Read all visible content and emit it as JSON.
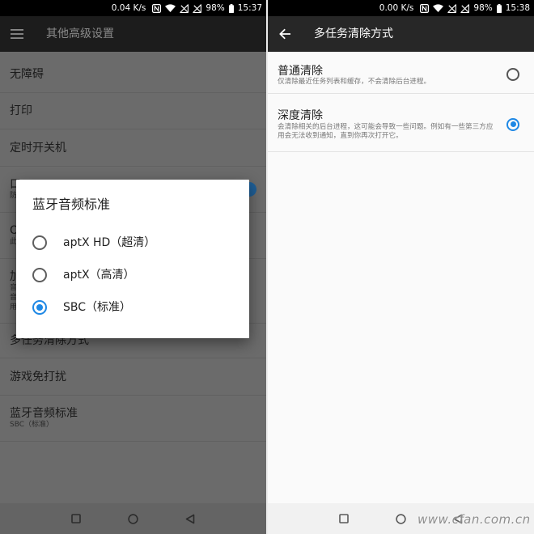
{
  "left_screen": {
    "status_bar": {
      "net_speed": "0.04 K/s",
      "battery_percent": "98%",
      "time": "15:37",
      "icons": [
        "nfc-icon",
        "wifi-icon",
        "no-signal-icon",
        "no-signal-icon",
        "battery-icon"
      ]
    },
    "toolbar": {
      "menu_icon": "menu-icon",
      "title": "其他高级设置"
    },
    "settings_list": [
      {
        "title": "无障碍"
      },
      {
        "title": "打印"
      },
      {
        "title": "定时开关机"
      },
      {
        "title": "口",
        "subtitle": "防",
        "toggle_on": true
      },
      {
        "title": "O",
        "subtitle": "此"
      },
      {
        "title": "加",
        "subtitle_lines": [
          "音",
          "音",
          "用"
        ]
      },
      {
        "title": "多任务清除方式"
      },
      {
        "title": "游戏免打扰"
      },
      {
        "title": "蓝牙音频标准",
        "subtitle": "SBC（标准）"
      }
    ],
    "dialog": {
      "title": "蓝牙音频标准",
      "options": [
        {
          "label": "aptX HD（超清）",
          "selected": false
        },
        {
          "label": "aptX（高清）",
          "selected": false
        },
        {
          "label": "SBC（标准）",
          "selected": true
        }
      ]
    },
    "nav_bar": {
      "icons": [
        "recents-square-icon",
        "home-circle-icon",
        "back-triangle-icon"
      ]
    }
  },
  "right_screen": {
    "status_bar": {
      "net_speed": "0.00 K/s",
      "battery_percent": "98%",
      "time": "15:38",
      "icons": [
        "nfc-icon",
        "wifi-icon",
        "no-signal-icon",
        "no-signal-icon",
        "battery-icon"
      ]
    },
    "toolbar": {
      "back_icon": "back-arrow-icon",
      "title": "多任务清除方式"
    },
    "options": [
      {
        "title": "普通清除",
        "description": "仅清除最近任务列表和缓存，不会清除后台进程。",
        "selected": false
      },
      {
        "title": "深度清除",
        "description": "会清除相关的后台进程，这可能会导致一些问题。例如有一些第三方应用会无法收到通知，直到你再次打开它。",
        "selected": true
      }
    ],
    "nav_bar": {
      "icons": [
        "recents-square-icon",
        "home-circle-icon",
        "back-triangle-icon"
      ]
    }
  },
  "watermark": "www.cfan.com.cn",
  "colors": {
    "accent_blue": "#1e88e5",
    "status_bar": "#000000",
    "toolbar_dark": "#272727",
    "dimmed_background": "#6b6b6b",
    "page_background": "#fafafa",
    "dialog_background": "#ffffff"
  }
}
